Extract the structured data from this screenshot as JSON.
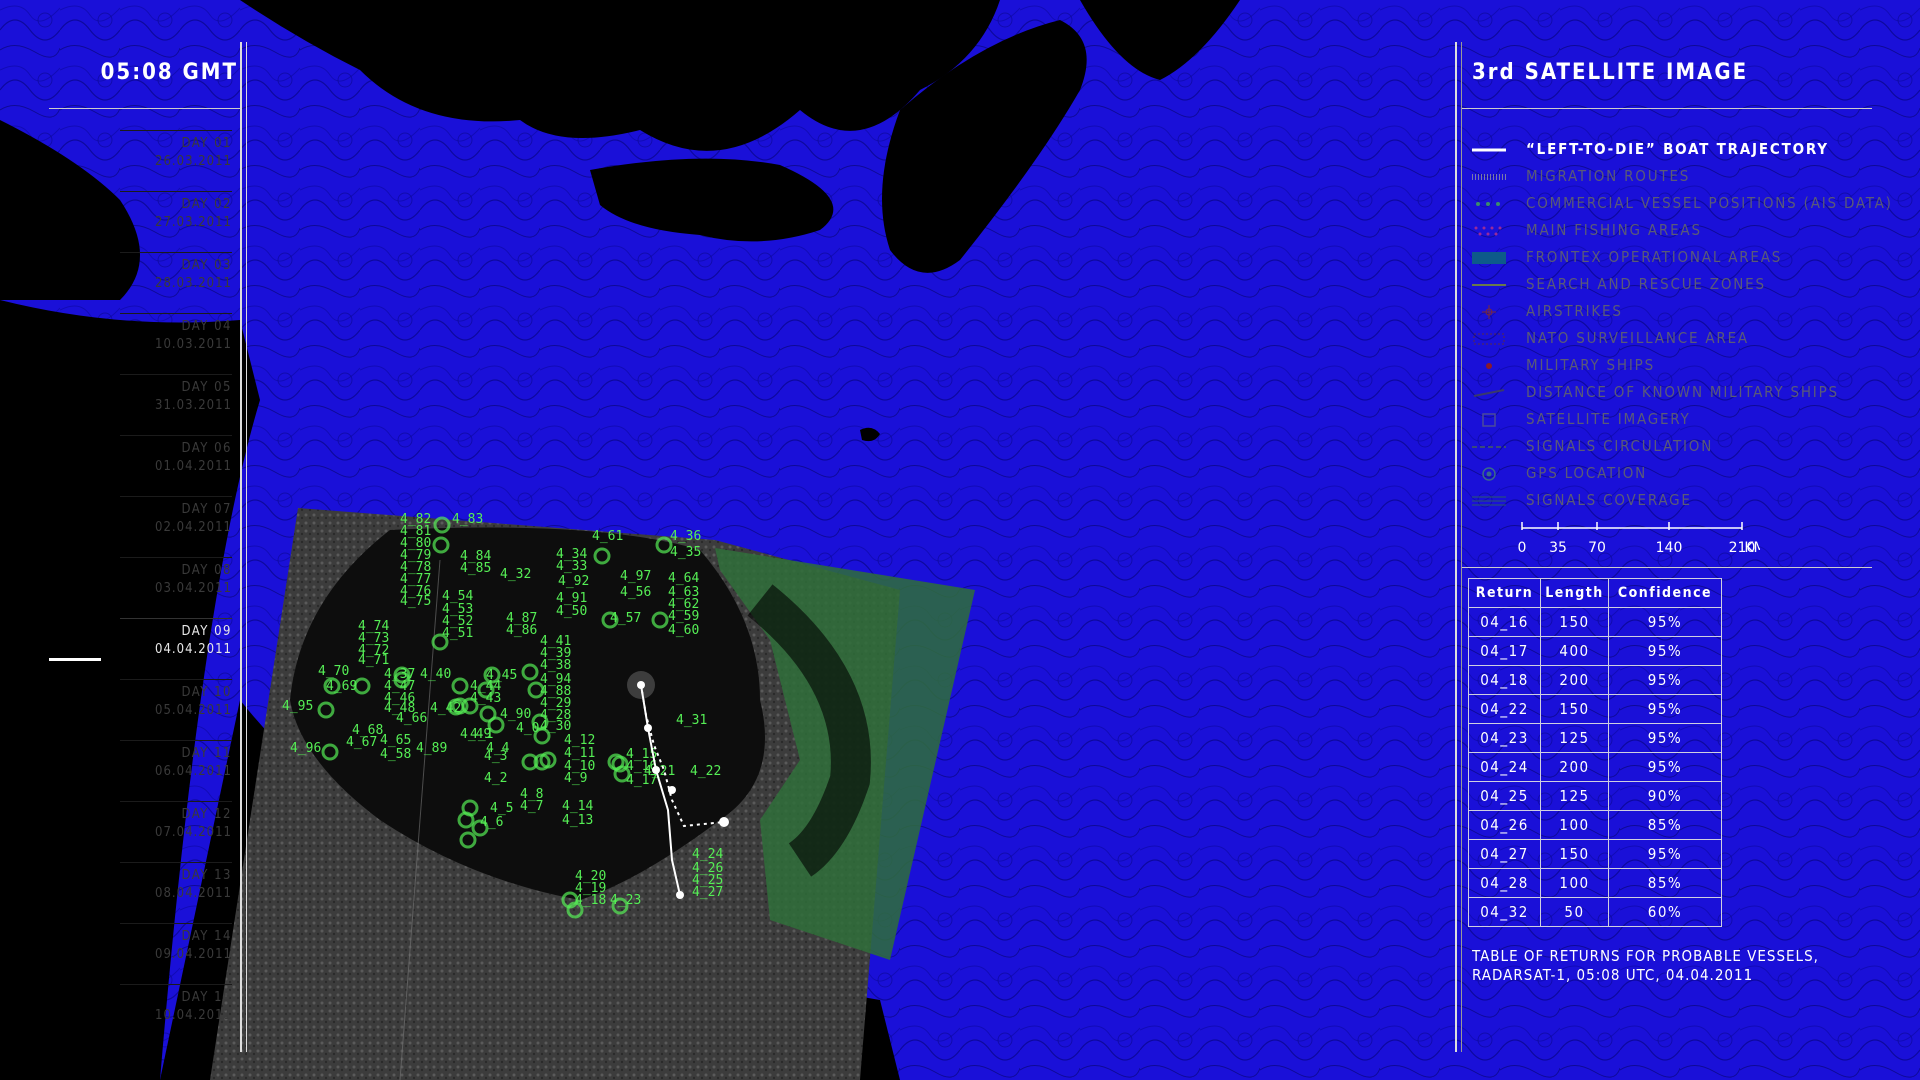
{
  "header": {
    "clock": "05:08 GMT",
    "panel_title": "3rd SATELLITE IMAGE"
  },
  "timeline": {
    "days": [
      {
        "label": "DAY 01",
        "date": "26.03.2011"
      },
      {
        "label": "DAY 02",
        "date": "27.03.2011"
      },
      {
        "label": "DAY 03",
        "date": "28.03.2011"
      },
      {
        "label": "DAY 04",
        "date": "10.03.2011"
      },
      {
        "label": "DAY 05",
        "date": "31.03.2011"
      },
      {
        "label": "DAY 06",
        "date": "01.04.2011"
      },
      {
        "label": "DAY 07",
        "date": "02.04.2011"
      },
      {
        "label": "DAY 08",
        "date": "03.04.2011"
      },
      {
        "label": "DAY 09",
        "date": "04.04.2011"
      },
      {
        "label": "DAY 10",
        "date": "05.04.2011"
      },
      {
        "label": "DAY 11",
        "date": "06.04.2011"
      },
      {
        "label": "DAY 12",
        "date": "07.04.2011"
      },
      {
        "label": "DAY 13",
        "date": "08.04.2011"
      },
      {
        "label": "DAY 14",
        "date": "09.04.2011"
      },
      {
        "label": "DAY 15",
        "date": "10.04.2011"
      }
    ],
    "active_index": 8
  },
  "legend": {
    "items": [
      {
        "label": "“LEFT-TO-DIE” BOAT TRAJECTORY",
        "icon": "trajectory-line-icon",
        "active": true
      },
      {
        "label": "MIGRATION ROUTES",
        "icon": "migration-routes-icon",
        "active": false
      },
      {
        "label": "COMMERCIAL VESSEL POSITIONS (AIS DATA)",
        "icon": "ais-dots-icon",
        "active": false
      },
      {
        "label": "MAIN FISHING AREAS",
        "icon": "fishing-areas-icon",
        "active": false
      },
      {
        "label": "FRONTEX OPERATIONAL AREAS",
        "icon": "frontex-area-icon",
        "active": false
      },
      {
        "label": "SEARCH AND RESCUE ZONES",
        "icon": "sar-zone-icon",
        "active": false
      },
      {
        "label": "AIRSTRIKES",
        "icon": "airstrike-icon",
        "active": false
      },
      {
        "label": "NATO SURVEILLANCE AREA",
        "icon": "nato-area-icon",
        "active": false
      },
      {
        "label": "MILITARY SHIPS",
        "icon": "military-ship-icon",
        "active": false
      },
      {
        "label": "DISTANCE OF KNOWN MILITARY SHIPS",
        "icon": "distance-icon",
        "active": false
      },
      {
        "label": "SATELLITE IMAGERY",
        "icon": "satellite-square-icon",
        "active": false
      },
      {
        "label": "SIGNALS CIRCULATION",
        "icon": "signals-circulation-icon",
        "active": false
      },
      {
        "label": "GPS LOCATION",
        "icon": "gps-target-icon",
        "active": false
      },
      {
        "label": "SIGNALS COVERAGE",
        "icon": "signals-coverage-icon",
        "active": false
      }
    ]
  },
  "scale": {
    "ticks": [
      "0",
      "35",
      "70",
      "140",
      "210"
    ],
    "unit": "KM"
  },
  "table": {
    "headers": [
      "Return",
      "Length",
      "Confidence"
    ],
    "rows": [
      [
        "04_16",
        "150",
        "95%"
      ],
      [
        "04_17",
        "400",
        "95%"
      ],
      [
        "04_18",
        "200",
        "95%"
      ],
      [
        "04_22",
        "150",
        "95%"
      ],
      [
        "04_23",
        "125",
        "95%"
      ],
      [
        "04_24",
        "200",
        "95%"
      ],
      [
        "04_25",
        "125",
        "90%"
      ],
      [
        "04_26",
        "100",
        "85%"
      ],
      [
        "04_27",
        "150",
        "95%"
      ],
      [
        "04_28",
        "100",
        "85%"
      ],
      [
        "04_32",
        "50",
        "60%"
      ]
    ],
    "caption_line1": "TABLE OF RETURNS FOR PROBABLE VESSELS,",
    "caption_line2": "RADARSAT-1, 05:08 UTC, 04.04.2011"
  },
  "colors": {
    "sea": "#1a10d8",
    "land": "#000000",
    "vessel": "#55ee55",
    "overlay_green": "#2f6f3a"
  },
  "vessel_labels": [
    "4_83",
    "4_82",
    "4_81",
    "4_80",
    "4_79",
    "4_78",
    "4_77",
    "4_76",
    "4_75",
    "4_84",
    "4_85",
    "4_34",
    "4_33",
    "4_32",
    "4_61",
    "4_36",
    "4_35",
    "4_97",
    "4_92",
    "4_56",
    "4_64",
    "4_63",
    "4_62",
    "4_54",
    "4_53",
    "4_52",
    "4_51",
    "4_91",
    "4_50",
    "4_57",
    "4_59",
    "4_60",
    "4_74",
    "4_73",
    "4_72",
    "4_71",
    "4_87",
    "4_86",
    "4_41",
    "4_39",
    "4_38",
    "4_94",
    "4_70",
    "4_69",
    "4_37",
    "4_40",
    "4_45",
    "4_44",
    "4_43",
    "4_88",
    "4_29",
    "4_28",
    "4_95",
    "4_47",
    "4_46",
    "4_48",
    "4_42",
    "4_49",
    "4_66",
    "4_90",
    "4_68",
    "4_67",
    "4_96",
    "4_65",
    "4_58",
    "4_89",
    "4_0",
    "4_1",
    "4_30",
    "4_12",
    "4_11",
    "4_10",
    "4_9",
    "4_3",
    "4_2",
    "4_4",
    "4_31",
    "4_15",
    "4_16",
    "4_17",
    "4_21",
    "4_22",
    "4_8",
    "4_7",
    "4_5",
    "4_6",
    "4_14",
    "4_13",
    "4_24",
    "4_26",
    "4_25",
    "4_27",
    "4_20",
    "4_19",
    "4_18",
    "4_23"
  ]
}
